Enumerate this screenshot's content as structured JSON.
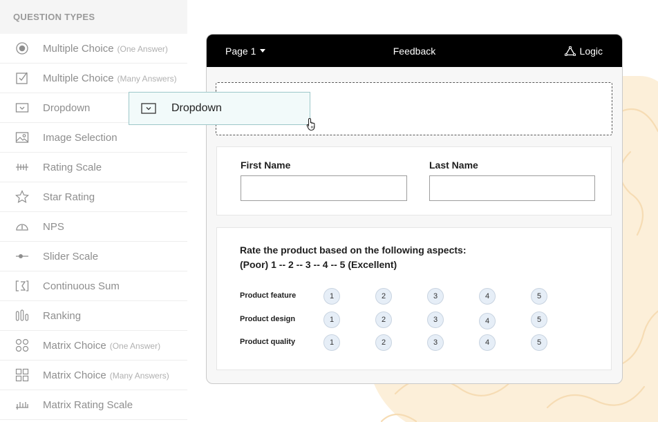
{
  "sidebar": {
    "header": "QUESTION TYPES",
    "items": [
      {
        "label": "Multiple Choice",
        "sub": "(One Answer)",
        "icon": "radio-icon"
      },
      {
        "label": "Multiple Choice",
        "sub": "(Many Answers)",
        "icon": "checkbox-icon"
      },
      {
        "label": "Dropdown",
        "sub": "",
        "icon": "dropdown-icon"
      },
      {
        "label": "Image Selection",
        "sub": "",
        "icon": "image-icon"
      },
      {
        "label": "Rating Scale",
        "sub": "",
        "icon": "rating-scale-icon"
      },
      {
        "label": "Star Rating",
        "sub": "",
        "icon": "star-icon"
      },
      {
        "label": "NPS",
        "sub": "",
        "icon": "gauge-icon"
      },
      {
        "label": "Slider Scale",
        "sub": "",
        "icon": "slider-icon"
      },
      {
        "label": "Continuous Sum",
        "sub": "",
        "icon": "sum-icon"
      },
      {
        "label": "Ranking",
        "sub": "",
        "icon": "ranking-icon"
      },
      {
        "label": "Matrix Choice",
        "sub": "(One Answer)",
        "icon": "matrix-radio-icon"
      },
      {
        "label": "Matrix Choice",
        "sub": "(Many Answers)",
        "icon": "matrix-checkbox-icon"
      },
      {
        "label": "Matrix Rating Scale",
        "sub": "",
        "icon": "matrix-rating-icon"
      }
    ]
  },
  "drag_ghost": {
    "label": "Dropdown",
    "icon": "dropdown-icon"
  },
  "builder": {
    "page_label": "Page 1",
    "title": "Feedback",
    "logic_label": "Logic",
    "first_name_label": "First Name",
    "last_name_label": "Last Name",
    "rating_question_line1": "Rate the product based on the following aspects:",
    "rating_question_line2": "(Poor) 1 -- 2 -- 3 -- 4 -- 5 (Excellent)",
    "rating_rows": [
      {
        "label": "Product feature",
        "options": [
          "1",
          "2",
          "3",
          "4",
          "5"
        ]
      },
      {
        "label": "Product design",
        "options": [
          "1",
          "2",
          "3",
          "4",
          "5"
        ]
      },
      {
        "label": "Product quality",
        "options": [
          "1",
          "2",
          "3",
          "4",
          "5"
        ]
      }
    ]
  },
  "colors": {
    "header_bg": "#000000",
    "ghost_border": "#9cc7c9",
    "circle_bg": "#e6eef7",
    "blob": "#fcefd9"
  }
}
